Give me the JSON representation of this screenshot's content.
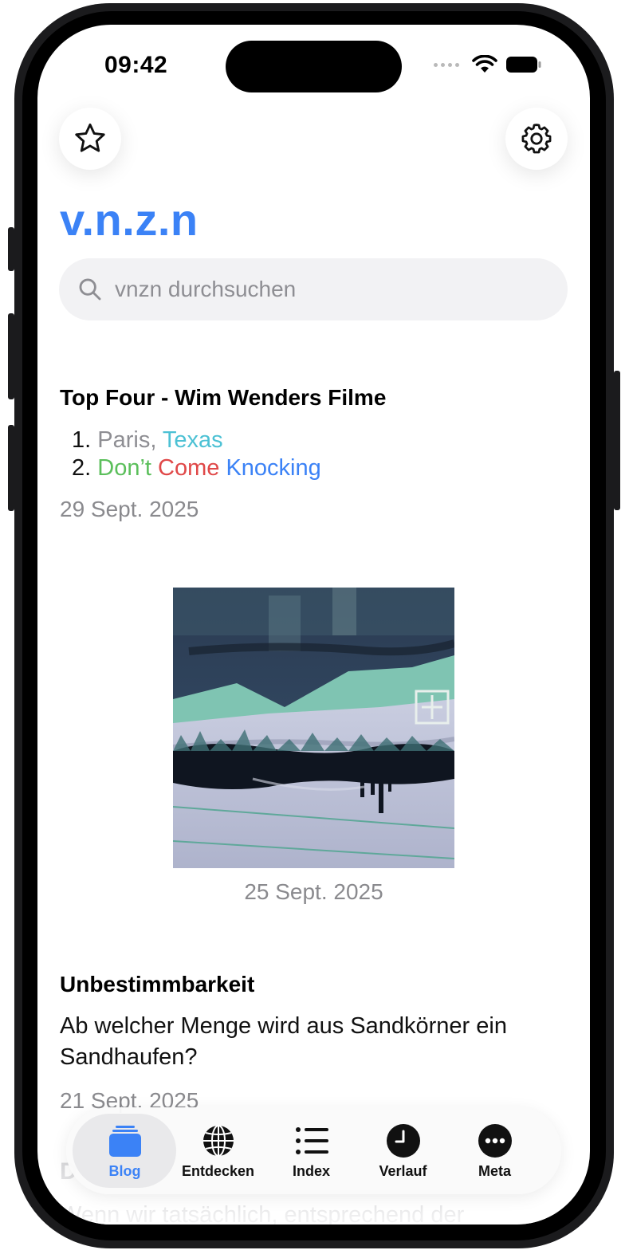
{
  "status_bar": {
    "time": "09:42"
  },
  "header": {
    "app_title": "v.n.z.n"
  },
  "search": {
    "placeholder": "vnzn durchsuchen"
  },
  "posts": [
    {
      "title": "Top Four - Wim Wenders Filme",
      "list": [
        {
          "number": "1.",
          "parts": [
            {
              "text": "Paris, ",
              "color": "#8e8e93"
            },
            {
              "text": "Texas",
              "color": "#4cc1d4"
            }
          ]
        },
        {
          "number": "2.",
          "parts": [
            {
              "text": "Don’t ",
              "color": "#5bbf5b"
            },
            {
              "text": "Come ",
              "color": "#e04848"
            },
            {
              "text": "Knocking",
              "color": "#3b82f6"
            }
          ]
        }
      ],
      "date": "29 Sept. 2025"
    },
    {
      "date": "25 Sept. 2025"
    },
    {
      "title": "Unbestimmbarkeit",
      "body": "Ab welcher Menge wird aus Sandkörner ein Sandhaufen?",
      "date": "21 Sept. 2025"
    },
    {
      "title": "D",
      "body": "Wenn wir tatsächlich, entsprechend der"
    }
  ],
  "tabbar": {
    "tabs": [
      {
        "label": "Blog",
        "icon": "stack-icon",
        "active": true
      },
      {
        "label": "Entdecken",
        "icon": "globe-icon"
      },
      {
        "label": "Index",
        "icon": "list-icon"
      },
      {
        "label": "Verlauf",
        "icon": "clock-icon"
      },
      {
        "label": "Meta",
        "icon": "ellipsis-icon"
      }
    ]
  },
  "colors": {
    "accent": "#3b82f6"
  }
}
